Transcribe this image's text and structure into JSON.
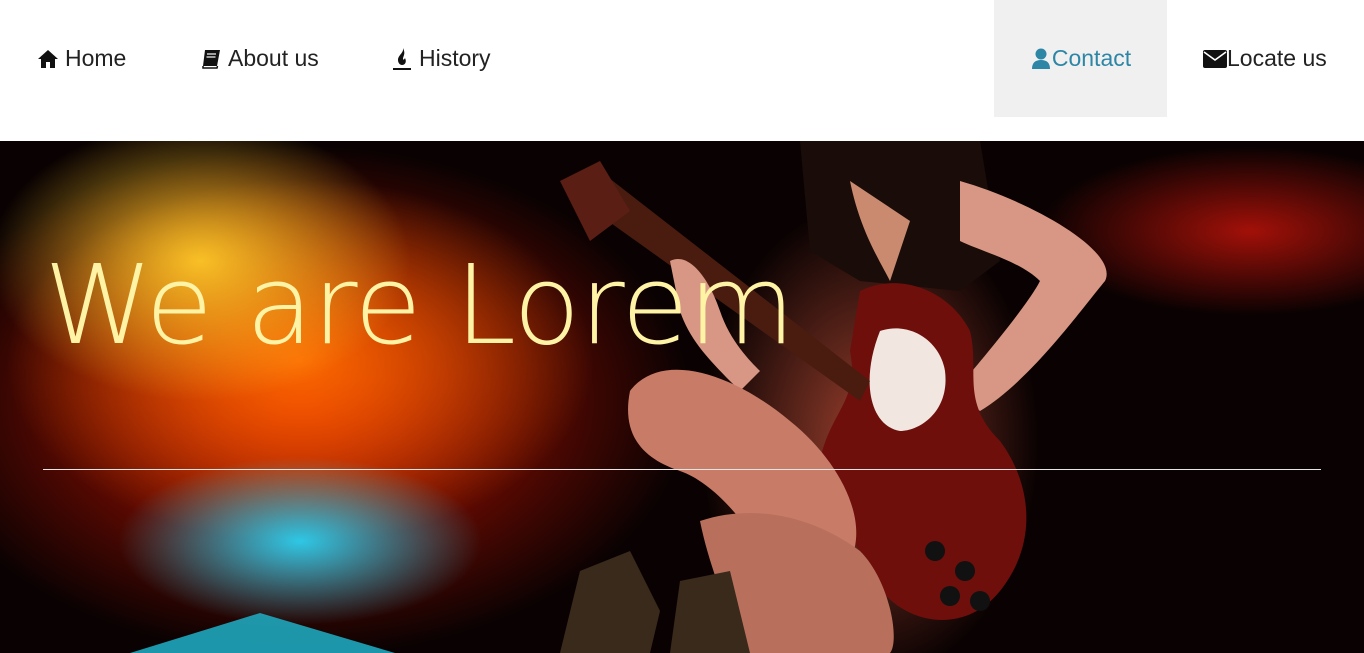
{
  "nav": {
    "items": [
      {
        "label": "Home",
        "icon": "home-icon"
      },
      {
        "label": "About us",
        "icon": "book-icon"
      },
      {
        "label": "History",
        "icon": "fire-icon"
      },
      {
        "label": "Contact",
        "icon": "user-icon",
        "active": true
      },
      {
        "label": "Locate us",
        "icon": "envelope-icon"
      }
    ]
  },
  "hero": {
    "title": "We are Lorem",
    "image": "guitarist-photo"
  },
  "colors": {
    "active_link": "#2d86a6",
    "active_bg": "#f0f0f0",
    "title": "#fff3a6"
  }
}
